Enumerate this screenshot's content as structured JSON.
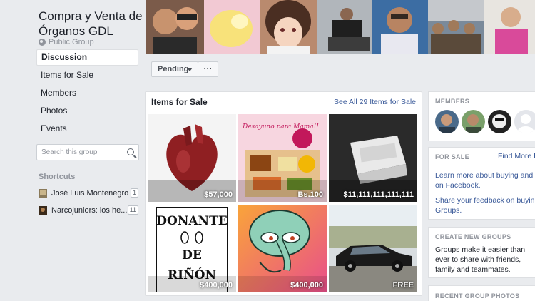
{
  "group": {
    "title": "Compra y Venta de Órganos GDL",
    "privacy": "Public Group"
  },
  "nav": {
    "items": [
      {
        "label": "Discussion",
        "active": true
      },
      {
        "label": "Items for Sale"
      },
      {
        "label": "Members"
      },
      {
        "label": "Photos"
      },
      {
        "label": "Events"
      }
    ]
  },
  "search": {
    "placeholder": "Search this group"
  },
  "shortcuts": {
    "heading": "Shortcuts",
    "items": [
      {
        "name": "José Luis Montenegro",
        "count": "1"
      },
      {
        "name": "Narcojuniors: los he...",
        "count": "11"
      }
    ]
  },
  "toolbar": {
    "pending_label": "Pending",
    "more_label": "···"
  },
  "items_for_sale": {
    "title": "Items for Sale",
    "see_all": "See All 29 Items for Sale",
    "tiles": [
      {
        "price": "$57,000"
      },
      {
        "price": "Bs.100",
        "image_text": "Desayuno para Mamá!!"
      },
      {
        "price": "$11,111,111,111,111"
      },
      {
        "price": "$400,000",
        "image_text_1": "DONANTE",
        "image_text_2": "DE",
        "image_text_3": "RIÑÓN"
      },
      {
        "price": "$400,000"
      },
      {
        "price": "FREE"
      }
    ]
  },
  "members": {
    "heading": "MEMBERS"
  },
  "for_sale": {
    "heading": "FOR SALE",
    "find_more": "Find More B",
    "link1": "Learn more about buying and s",
    "link1b": "on Facebook.",
    "link2": "Share your feedback on buyin",
    "link2b": "Groups."
  },
  "create_groups": {
    "heading": "CREATE NEW GROUPS",
    "text1": "Groups make it easier than",
    "text2": "ever to share with friends,",
    "text3": "family and teammates."
  },
  "recent_photos": {
    "heading": "RECENT GROUP PHOTOS"
  },
  "colors": {
    "link": "#385898",
    "background": "#e9ebee",
    "muted": "#90949c"
  }
}
